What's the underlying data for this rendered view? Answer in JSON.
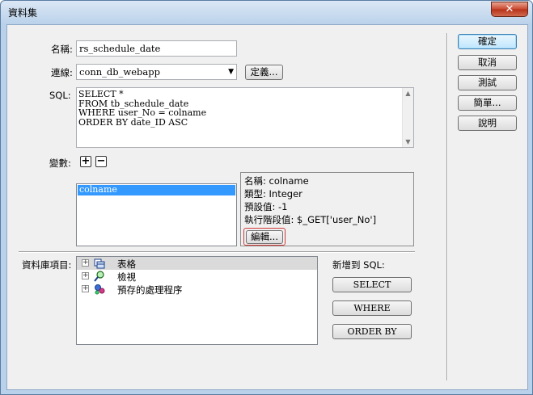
{
  "window": {
    "title": "資料集",
    "close_glyph": "✕"
  },
  "form": {
    "name_label": "名稱:",
    "name_value": "rs_schedule_date",
    "connection_label": "連線:",
    "connection_value": "conn_db_webapp",
    "define_button": "定義...",
    "sql_label": "SQL:",
    "sql_lines": [
      "SELECT *",
      "FROM tb_schedule_date",
      "WHERE user_No = colname",
      "ORDER BY date_ID ASC"
    ],
    "variables_label": "變數:",
    "add_glyph": "+",
    "remove_glyph": "−"
  },
  "variables": {
    "list": [
      "colname"
    ],
    "detail": {
      "name": "名稱: colname",
      "type": "類型: Integer",
      "default": "預設值: -1",
      "runtime": "執行階段值: $_GET['user_No']"
    },
    "edit_button": "編輯..."
  },
  "database": {
    "label": "資料庫項目:",
    "items": [
      {
        "label": "表格",
        "icon": "table-icon",
        "expander": "+"
      },
      {
        "label": "檢視",
        "icon": "view-icon",
        "expander": "+"
      },
      {
        "label": "預存的處理程序",
        "icon": "stored-procedure-icon",
        "expander": "+"
      }
    ],
    "add_to_sql_label": "新增到 SQL:",
    "buttons": {
      "select": "SELECT",
      "where": "WHERE",
      "orderby": "ORDER BY"
    }
  },
  "actions": {
    "ok": "確定",
    "cancel": "取消",
    "test": "測試",
    "simple": "簡單...",
    "help": "說明"
  }
}
